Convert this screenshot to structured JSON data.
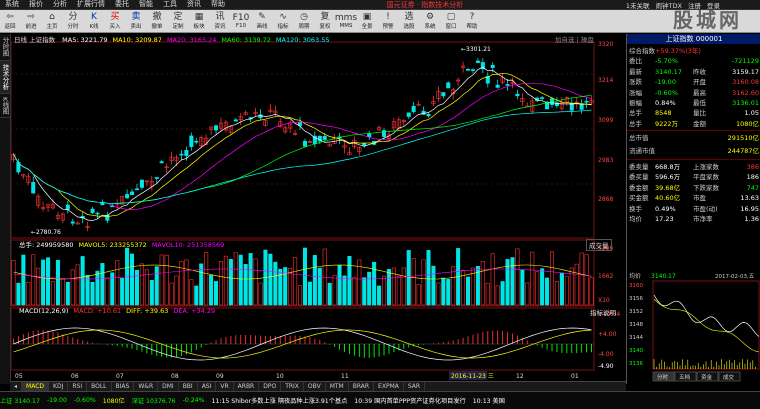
{
  "menu": {
    "items": [
      "系统",
      "报价",
      "分析",
      "扩展行情",
      "委托",
      "智能",
      "工具",
      "资讯",
      "帮助"
    ],
    "center": "国元证券 · 指数技术分析",
    "right": [
      "1未关联",
      "闹钟TDX",
      "注册",
      "登录"
    ]
  },
  "toolbar": {
    "buttons": [
      {
        "label": "返回",
        "icon": "⇦",
        "name": "back"
      },
      {
        "label": "前进",
        "icon": "⇨",
        "name": "forward"
      },
      {
        "label": "主页",
        "icon": "⌂",
        "name": "home"
      },
      {
        "label": "分时",
        "icon": "分",
        "name": "timeshare"
      },
      {
        "label": "K线",
        "icon": "K",
        "name": "kline"
      },
      {
        "label": "买入",
        "icon": "买",
        "name": "buy"
      },
      {
        "label": "卖出",
        "icon": "卖",
        "name": "sell"
      },
      {
        "label": "撤单",
        "icon": "撤",
        "name": "cancel"
      },
      {
        "label": "定制",
        "icon": "定",
        "name": "custom"
      },
      {
        "label": "板块",
        "icon": "▦",
        "name": "sector"
      },
      {
        "label": "资讯",
        "icon": "讯",
        "name": "news"
      },
      {
        "label": "F10",
        "icon": "F10",
        "name": "f10"
      },
      {
        "label": "画线",
        "icon": "✎",
        "name": "draw"
      },
      {
        "label": "指标",
        "icon": "∿",
        "name": "indicator"
      },
      {
        "label": "周期",
        "icon": "◷",
        "name": "period"
      },
      {
        "label": "复权",
        "icon": "复",
        "name": "restore"
      },
      {
        "label": "MMS",
        "icon": "mms",
        "name": "mms"
      },
      {
        "label": "全景",
        "icon": "▣",
        "name": "panorama"
      },
      {
        "label": "预警",
        "icon": "!",
        "name": "alert"
      },
      {
        "label": "选股",
        "icon": "选",
        "name": "select"
      },
      {
        "label": "系统",
        "icon": "⚙",
        "name": "system"
      },
      {
        "label": "窗口",
        "icon": "▢",
        "name": "window"
      },
      {
        "label": "帮助",
        "icon": "?",
        "name": "help"
      }
    ]
  },
  "watermark": "股城网",
  "left_tabs": [
    "分时图",
    "技术分析",
    "K线图"
  ],
  "kline": {
    "name": "上证指数",
    "ma_labels": [
      {
        "text": "MA5: 3221.79",
        "color": "#ffffff"
      },
      {
        "text": "MA10: 3209.87",
        "color": "#ffff00"
      },
      {
        "text": "MA20: 3165.24",
        "color": "#ff00ff"
      },
      {
        "text": "MA60: 3139.72",
        "color": "#00ff00"
      },
      {
        "text": "MA120: 3063.55",
        "color": "#00ffff"
      }
    ],
    "top_right": "加自选 | 操盘",
    "ticks": [
      "3320",
      "3214",
      "3099",
      "2983",
      "2868"
    ],
    "high_label": "←3301.21",
    "low_label": "←2780.76"
  },
  "volume": {
    "labels": [
      {
        "text": "总手: 249959580",
        "color": "#ffffff"
      },
      {
        "text": "MAVOL5: 233255372",
        "color": "#ffff00"
      },
      {
        "text": "MAVOL10: 251358569",
        "color": "#ff00ff"
      }
    ],
    "badge": "成交量",
    "ticks": [
      "3296",
      "1662",
      "X10"
    ]
  },
  "macd": {
    "labels": [
      {
        "text": "MACD(12,26,9)",
        "color": "#ffffff"
      },
      {
        "text": "MACD: +10.61",
        "color": "#ff3333"
      },
      {
        "text": "DIFF: +39.63",
        "color": "#ffff00"
      },
      {
        "text": "DEA: +34.29",
        "color": "#ff00ff"
      }
    ],
    "badge": "指标说明",
    "ticks": [
      "+44.04",
      "+4.00",
      "-4.00",
      "-4.90"
    ]
  },
  "x_axis": {
    "labels": [
      "05",
      "06",
      "07",
      "08",
      "09",
      "10",
      "11",
      "2016-11-23 三",
      "12",
      "01"
    ]
  },
  "right_panel": {
    "title": "上证指数 000001",
    "rows1": [
      {
        "l": "综合指数",
        "m": "+59.37%(3年)",
        "r": "",
        "mc": "#ff3333"
      },
      {
        "l": "委比",
        "m": "-5.70%",
        "r": "-721129",
        "mc": "#00ff00",
        "rc": "#00ff00"
      },
      {
        "l": "最新",
        "m": "3140.17",
        "ml": "昨收",
        "r": "3159.17",
        "mc": "#00ff00",
        "rc": "#ffffff"
      },
      {
        "l": "涨跌",
        "m": "-19.00",
        "ml": "开盘",
        "r": "3160.08",
        "mc": "#00ff00",
        "rc": "#ff3333"
      },
      {
        "l": "涨幅",
        "m": "-0.60%",
        "ml": "最高",
        "r": "3162.60",
        "mc": "#00ff00",
        "rc": "#ff3333"
      },
      {
        "l": "振幅",
        "m": "0.84%",
        "ml": "最低",
        "r": "3136.01",
        "mc": "#ffffff",
        "rc": "#00ff00"
      },
      {
        "l": "总手",
        "m": "8548",
        "ml": "量比",
        "r": "1.05",
        "mc": "#ffff00",
        "rc": "#ffffff"
      },
      {
        "l": "总手",
        "m": "9222万",
        "ml": "金额",
        "r": "1080亿",
        "mc": "#ffff00",
        "rc": "#ffff00"
      }
    ],
    "rows2": [
      {
        "l": "总市值",
        "r": "291510亿",
        "rc": "#ffff00"
      },
      {
        "l": "流通市值",
        "r": "244787亿",
        "rc": "#ffff00"
      }
    ],
    "rows3": [
      {
        "l": "委卖量",
        "m": "668.8万",
        "ml": "上涨家数",
        "r": "386",
        "mc": "#ffffff",
        "rc": "#ff3333"
      },
      {
        "l": "委买量",
        "m": "596.6万",
        "ml": "平盘家数",
        "r": "186",
        "mc": "#ffffff",
        "rc": "#ffffff"
      },
      {
        "l": "委金额",
        "m": "39.68亿",
        "ml": "下跌家数",
        "r": "747",
        "mc": "#ffff00",
        "rc": "#00ff00"
      },
      {
        "l": "买金额",
        "m": "40.60亿",
        "ml": "市盈",
        "r": "13.63",
        "mc": "#ffff00",
        "rc": "#ffffff"
      },
      {
        "l": "换手",
        "m": "0.49%",
        "ml": "市盈(动)",
        "r": "16.95",
        "mc": "#ffffff",
        "rc": "#ffffff"
      },
      {
        "l": "均价",
        "m": "17.23",
        "ml": "市净率",
        "r": "1.36",
        "mc": "#ffffff",
        "rc": "#ffffff"
      }
    ],
    "mini": {
      "left": "均价",
      "value": "3140.17",
      "date": "2017-02-03,五",
      "ticks": [
        "3160",
        "3156",
        "3152",
        "3148",
        "3144",
        "3140",
        "3136"
      ],
      "bottom_tabs": [
        "分时",
        "五档",
        "资金",
        "成交"
      ]
    }
  },
  "bottom_tabs": [
    "MACD",
    "KDJ",
    "RSI",
    "BOLL",
    "BIAS",
    "W&R",
    "DMI",
    "BBI",
    "ASI",
    "VR",
    "ARBR",
    "DPO",
    "TRIX",
    "OBV",
    "MTM",
    "BRAR",
    "EXPMA",
    "SAR"
  ],
  "status": [
    {
      "text": "上证 3140.17",
      "color": "#00ff00"
    },
    {
      "text": "-19.00",
      "color": "#00ff00"
    },
    {
      "text": "-0.60%",
      "color": "#00ff00"
    },
    {
      "text": "1080亿",
      "color": "#ffff00"
    },
    {
      "text": "深证 10376.76",
      "color": "#00ff00"
    },
    {
      "text": "-0.24%",
      "color": "#00ff00"
    },
    {
      "text": "11:15 Shibor多数上涨 隔夜品种上涨3.91个基点",
      "color": "#ffffff"
    },
    {
      "text": "10:39 国内首单PPP资产证券化项目发行",
      "color": "#ffffff"
    },
    {
      "text": "10:13 美国",
      "color": "#ffffff"
    }
  ]
}
